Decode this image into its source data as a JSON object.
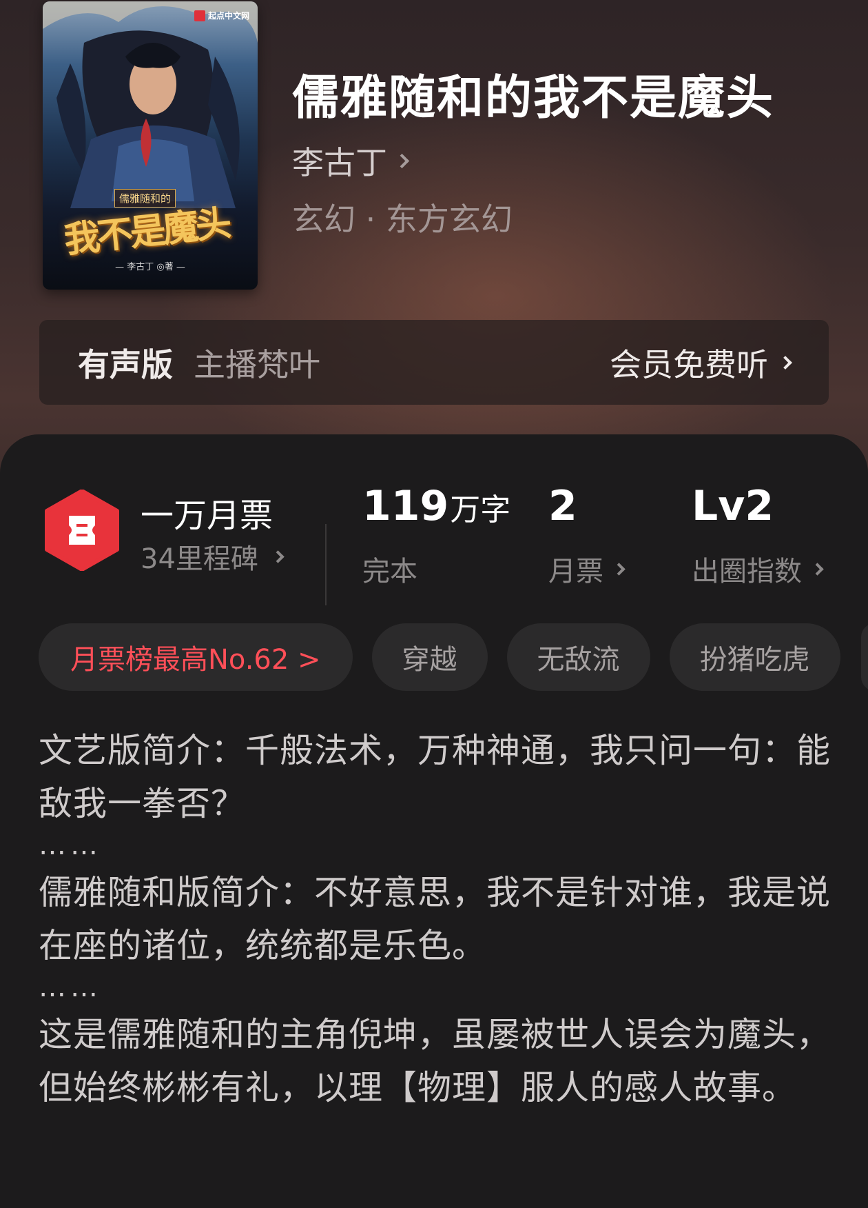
{
  "book": {
    "title": "儒雅随和的我不是魔头",
    "author": "李古丁",
    "genre": "玄幻 · 东方玄幻"
  },
  "cover": {
    "publisher": "起点中文网",
    "subtitle": "儒雅随和的",
    "title_art": "我不是魔头",
    "author_credit": "— 李古丁 ◎著 —"
  },
  "audio": {
    "label": "有声版",
    "host": "主播梵叶",
    "cta": "会员免费听"
  },
  "stats": {
    "milestone_title": "一万月票",
    "milestone_sub": "34里程碑",
    "words_value": "119",
    "words_unit": "万字",
    "words_label": "完本",
    "votes_value": "2",
    "votes_label": "月票",
    "index_value": "Lv2",
    "index_label": "出圈指数"
  },
  "tags": {
    "rank": "月票榜最高No.62 >",
    "t1": "穿越",
    "t2": "无敌流",
    "t3": "扮猪吃虎"
  },
  "synopsis": {
    "p1": "文艺版简介：千般法术，万种神通，我只问一句：能敌我一拳否？",
    "dots1": "……",
    "p2": "儒雅随和版简介：不好意思，我不是针对谁，我是说在座的诸位，统统都是乐色。",
    "dots2": "……",
    "p3": "这是儒雅随和的主角倪坤，虽屡被世人误会为魔头，但始终彬彬有礼，以理【物理】服人的感人故事。"
  },
  "colors": {
    "accent_red": "#ff4f58",
    "ticket_red": "#e8333b",
    "card_bg": "#1c1b1c"
  }
}
